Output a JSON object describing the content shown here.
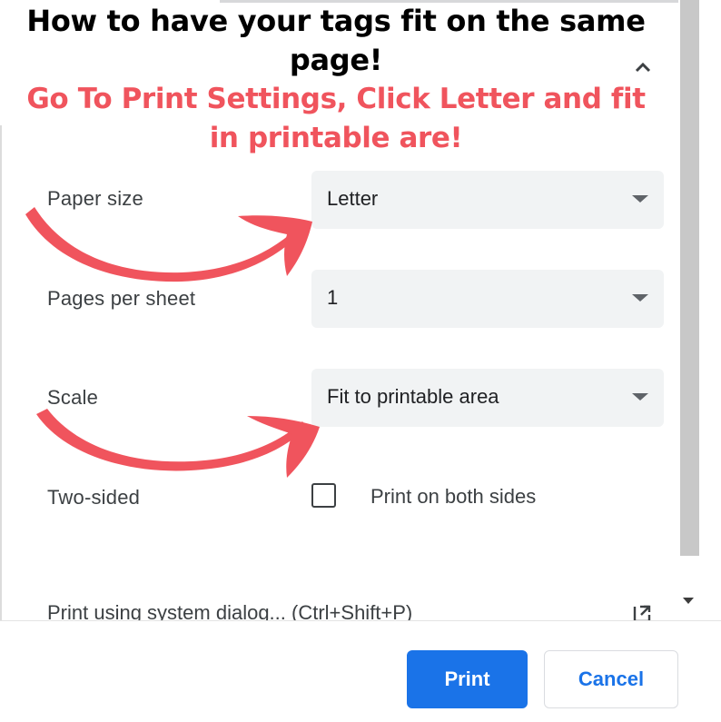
{
  "overlay": {
    "headline": "How to have your tags fit on the same page!",
    "instruction": "Go To Print Settings, Click Letter and fit in printable are!"
  },
  "settings": {
    "paper_size": {
      "label": "Paper size",
      "value": "Letter"
    },
    "pages_per_sheet": {
      "label": "Pages per sheet",
      "value": "1"
    },
    "scale": {
      "label": "Scale",
      "value": "Fit to printable area"
    },
    "two_sided": {
      "label": "Two-sided",
      "option_label": "Print on both sides",
      "checked": false
    }
  },
  "system_dialog_link": "Print using system dialog... (Ctrl+Shift+P)",
  "footer": {
    "print_label": "Print",
    "cancel_label": "Cancel"
  },
  "colors": {
    "accent": "#1a73e8",
    "annotation": "#f0545d",
    "select_bg": "#f1f3f4"
  },
  "icons": [
    "chevron-up-icon",
    "dropdown-caret-icon",
    "external-link-icon",
    "arrow-annotation"
  ]
}
